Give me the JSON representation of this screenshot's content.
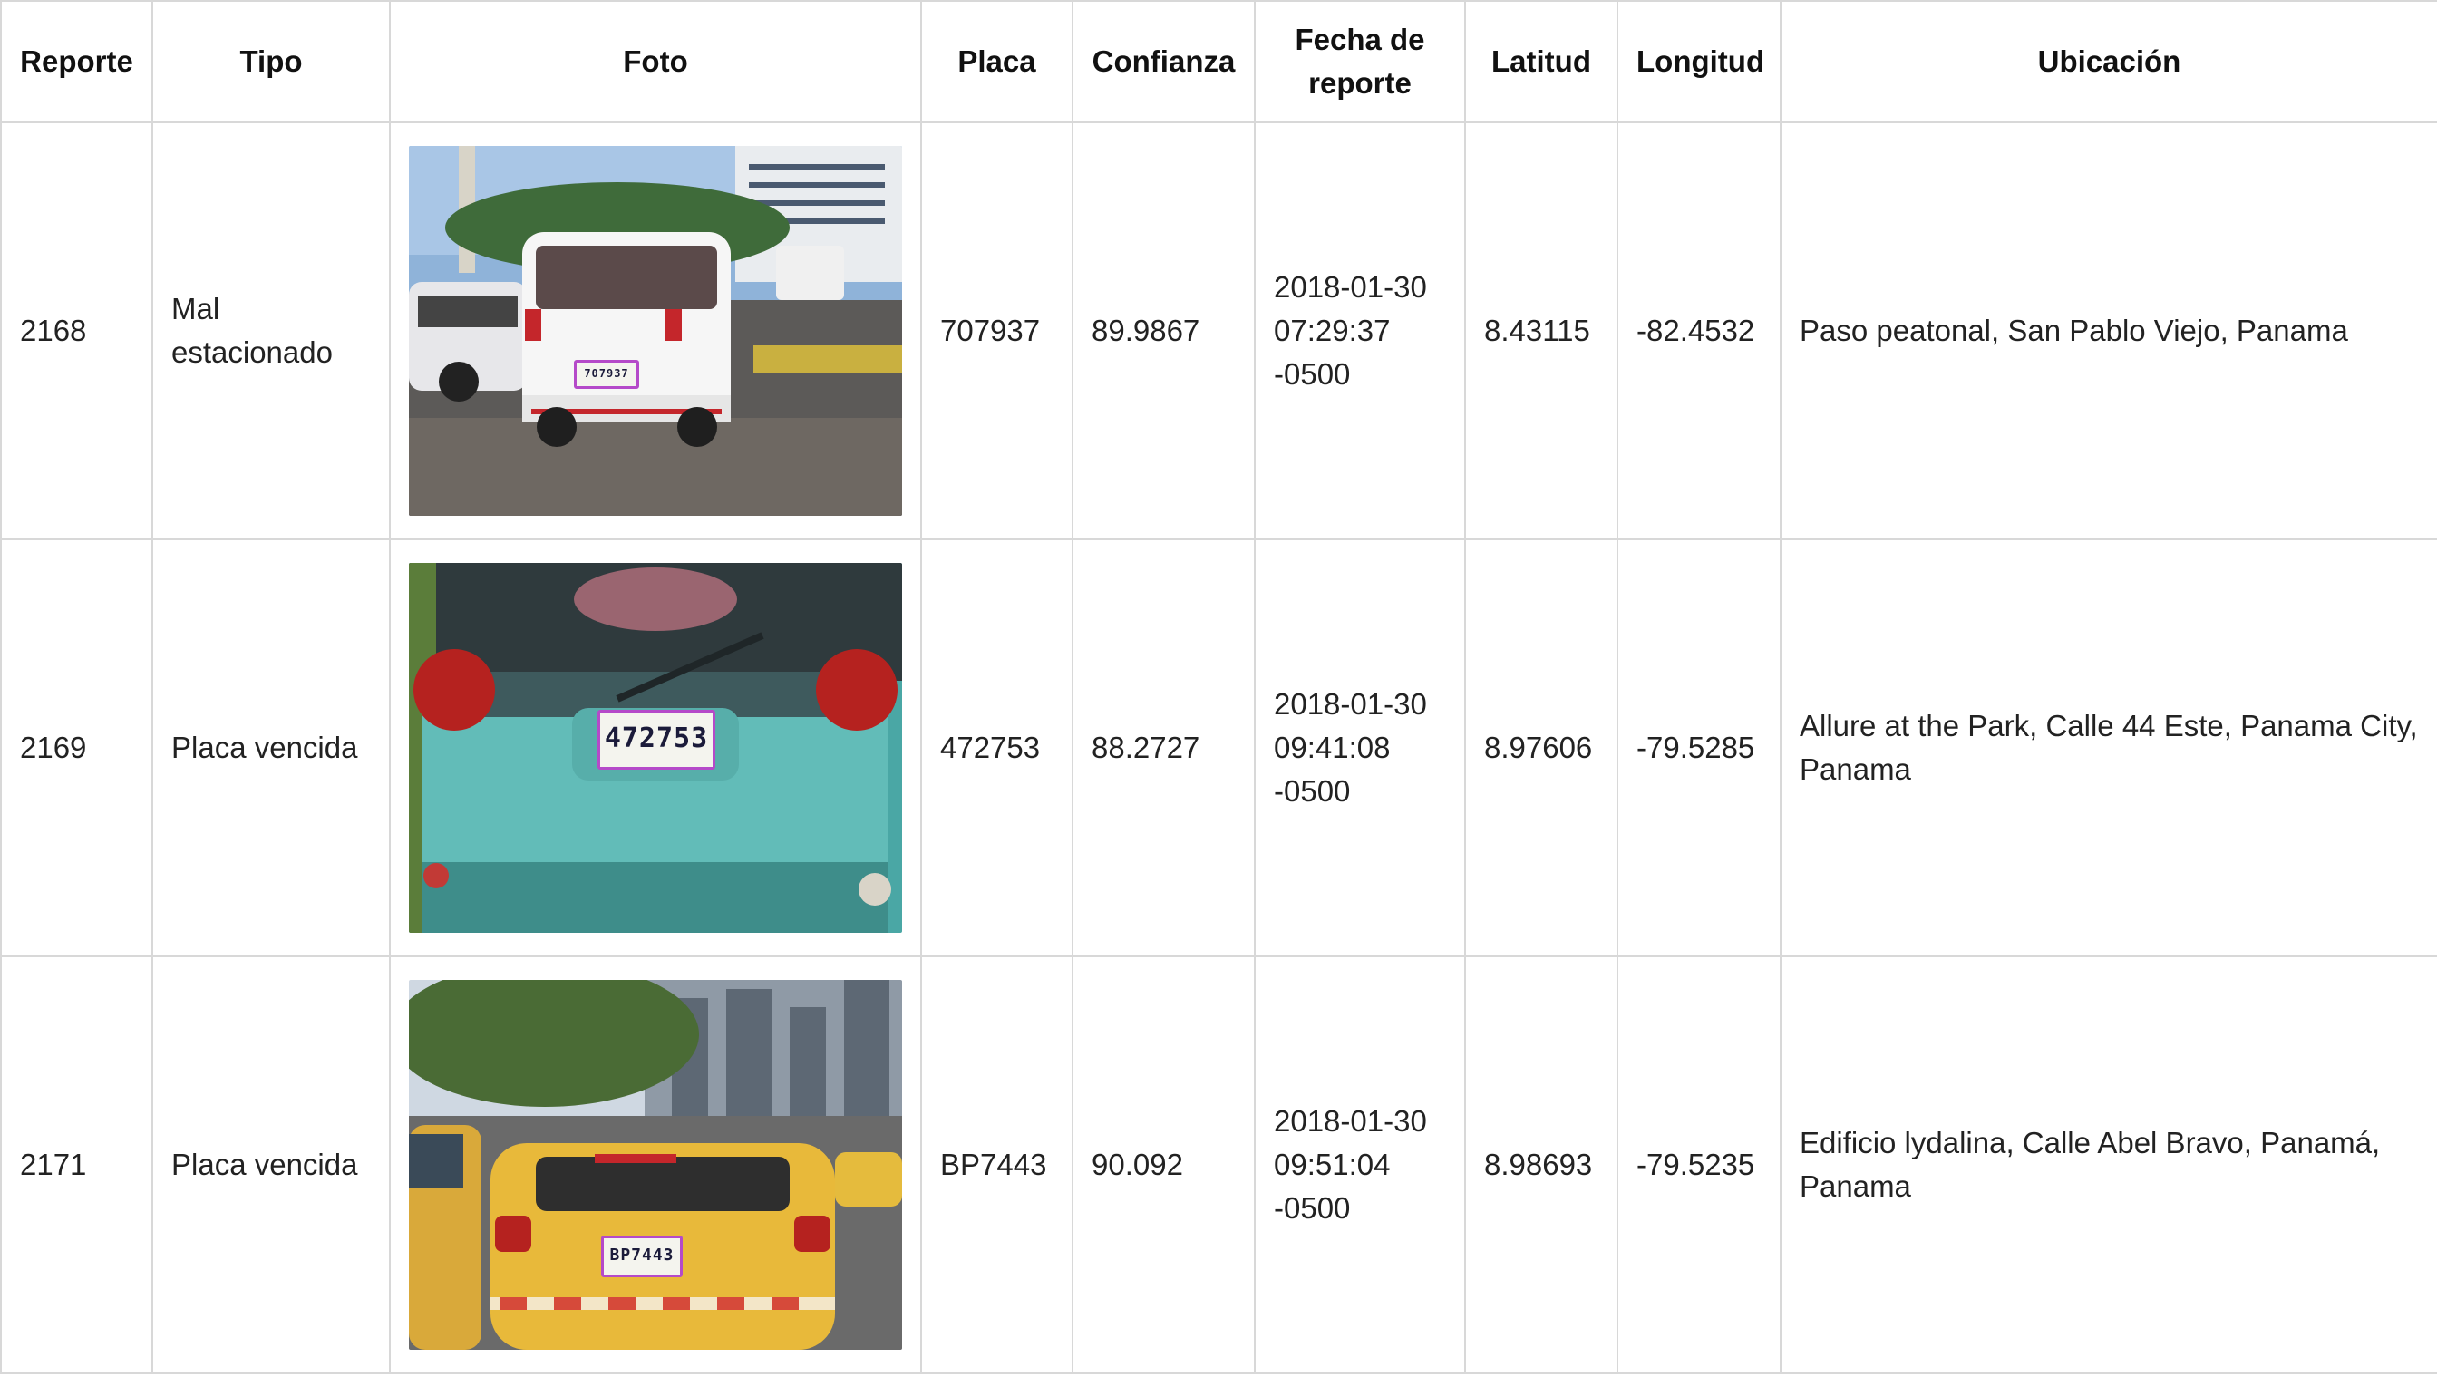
{
  "table": {
    "headers": {
      "reporte": "Reporte",
      "tipo": "Tipo",
      "foto": "Foto",
      "placa": "Placa",
      "confianza": "Confianza",
      "fecha": "Fecha de reporte",
      "latitud": "Latitud",
      "longitud": "Longitud",
      "ubicacion": "Ubicación"
    },
    "rows": [
      {
        "reporte": "2168",
        "tipo": "Mal estacionado",
        "photo_icon": "white-van-photo",
        "plate_in_photo": "707937",
        "placa": "707937",
        "confianza": "89.9867",
        "fecha": "2018-01-30 07:29:37 -0500",
        "latitud": "8.43115",
        "longitud": "-82.4532",
        "ubicacion": "Paso peatonal, San Pablo Viejo, Panama"
      },
      {
        "reporte": "2169",
        "tipo": "Placa vencida",
        "photo_icon": "teal-hatchback-photo",
        "plate_in_photo": "472753",
        "placa": "472753",
        "confianza": "88.2727",
        "fecha": "2018-01-30 09:41:08 -0500",
        "latitud": "8.97606",
        "longitud": "-79.5285",
        "ubicacion": "Allure at the Park, Calle 44 Este, Panama City, Panama"
      },
      {
        "reporte": "2171",
        "tipo": "Placa vencida",
        "photo_icon": "yellow-taxi-photo",
        "plate_in_photo": "BP7443",
        "placa": "BP7443",
        "confianza": "90.092",
        "fecha": "2018-01-30 09:51:04 -0500",
        "latitud": "8.98693",
        "longitud": "-79.5235",
        "ubicacion": "Edificio lydalina, Calle Abel Bravo, Panamá, Panama"
      }
    ]
  },
  "colors": {
    "border": "#d8d8d8",
    "plate_outline": "#b54ac9",
    "taxi_yellow": "#e8b93a",
    "teal_car": "#5fb8b4"
  }
}
